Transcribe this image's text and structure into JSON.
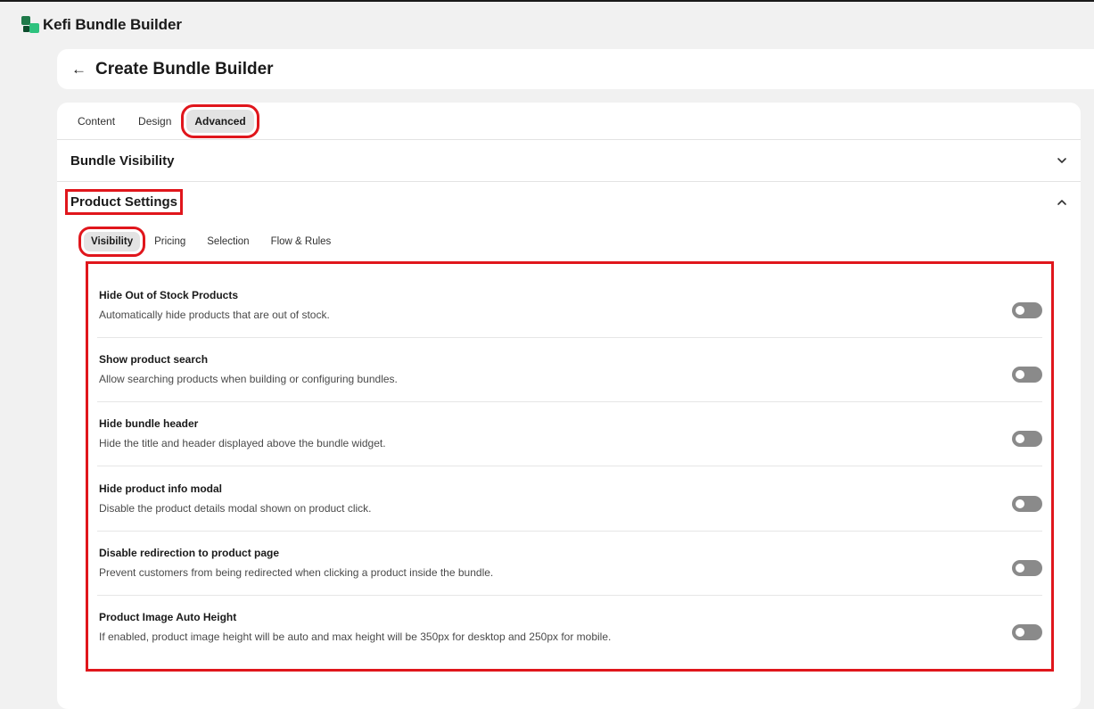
{
  "app": {
    "title": "Kefi Bundle Builder"
  },
  "header": {
    "back_icon": "arrow-left-icon",
    "title": "Create Bundle Builder"
  },
  "tabs": [
    {
      "label": "Content",
      "active": false
    },
    {
      "label": "Design",
      "active": false
    },
    {
      "label": "Advanced",
      "active": true
    }
  ],
  "sections": {
    "bundle_visibility": {
      "title": "Bundle Visibility",
      "expanded": false,
      "icon": "chevron-down-icon"
    },
    "product_settings": {
      "title": "Product Settings",
      "expanded": true,
      "icon": "chevron-up-icon"
    }
  },
  "sub_tabs": [
    {
      "label": "Visibility",
      "active": true
    },
    {
      "label": "Pricing",
      "active": false
    },
    {
      "label": "Selection",
      "active": false
    },
    {
      "label": "Flow & Rules",
      "active": false
    }
  ],
  "settings": [
    {
      "title": "Hide Out of Stock Products",
      "description": "Automatically hide products that are out of stock.",
      "enabled": false
    },
    {
      "title": "Show product search",
      "description": "Allow searching products when building or configuring bundles.",
      "enabled": false
    },
    {
      "title": "Hide bundle header",
      "description": "Hide the title and header displayed above the bundle widget.",
      "enabled": false
    },
    {
      "title": "Hide product info modal",
      "description": "Disable the product details modal shown on product click.",
      "enabled": false
    },
    {
      "title": "Disable redirection to product page",
      "description": "Prevent customers from being redirected when clicking a product inside the bundle.",
      "enabled": false
    },
    {
      "title": "Product Image Auto Height",
      "description": "If enabled, product image height will be auto and max height will be 350px for desktop and 250px for mobile.",
      "enabled": false
    }
  ],
  "colors": {
    "highlight": "#e0161c",
    "toggle_off": "#8a8a8a",
    "brand": "#2ec27e"
  }
}
